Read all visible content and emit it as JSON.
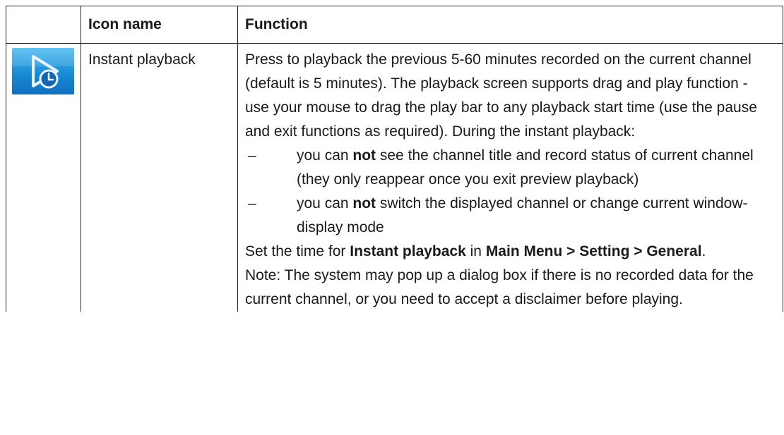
{
  "table": {
    "headers": {
      "icon": "",
      "name": "Icon name",
      "function": "Function"
    },
    "row": {
      "icon_name": "instant-playback-icon",
      "name": "Instant playback",
      "intro": "Press to playback the previous 5-60 minutes recorded on the current channel (default is 5 minutes). The playback screen supports drag and play function - use your mouse to drag the play bar to any playback start time (use the pause and exit functions as required). During the instant playback:",
      "bullets": [
        {
          "dash": "–",
          "pre": "you can ",
          "bold": "not",
          "post": " see the channel title and record status of current channel (they only reappear once you exit preview playback)"
        },
        {
          "dash": "–",
          "pre": "you can ",
          "bold": "not",
          "post": " switch the displayed channel or change current window-display mode"
        }
      ],
      "setting": {
        "pre": "Set the time for ",
        "bold1": "Instant playback",
        "mid": " in ",
        "bold2": "Main Menu > Setting > General",
        "post": "."
      },
      "note": "Note: The system may pop up a dialog box if there is no recorded data for the current channel, or you need to accept a disclaimer before playing."
    }
  },
  "colors": {
    "icon_top": "#4bbcf0",
    "icon_bottom": "#0f6fbf"
  }
}
